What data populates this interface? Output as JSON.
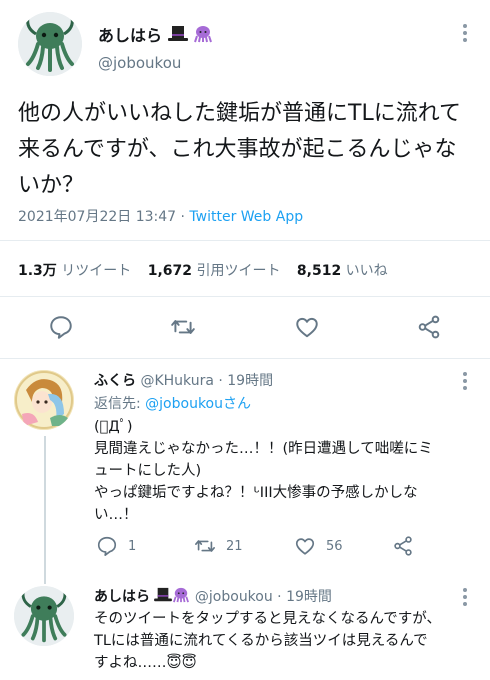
{
  "main_tweet": {
    "display_name": "あしはら",
    "handle": "@joboukou",
    "text": "他の人がいいねした鍵垢が普通にTLに流れて来るんですが、これ大事故が起こるんじゃないか？",
    "timestamp": "2021年07月22日 13:47 · ",
    "app": "Twitter Web App",
    "stats": {
      "retweets_count": "1.3万",
      "retweets_label": "リツイート",
      "quotes_count": "1,672",
      "quotes_label": "引用ツイート",
      "likes_count": "8,512",
      "likes_label": "いいね"
    }
  },
  "reply1": {
    "display_name": "ふくら",
    "handle": "@KHukura",
    "time": " · 19時間",
    "reply_prefix": "返信先: ",
    "reply_to": "@joboukouさん",
    "text_lines": [
      "(ﾟДﾟ)",
      "見間違えじゃなかった…！！(昨日遭遇して咄嗟にミ",
      "ュートにした人)",
      "やっぱ鍵垢ですよね？！ᒡIII大惨事の予感しかしな",
      "い…！"
    ],
    "actions": {
      "reply_count": "1",
      "retweet_count": "21",
      "like_count": "56"
    }
  },
  "reply2": {
    "display_name": "あしはら",
    "handle": "@joboukou",
    "time": " · 19時間",
    "text_lines": [
      "そのツイートをタップすると見えなくなるんですが、",
      "TLには普通に流れてくるから該当ツイは見えるんで",
      "すよね……😇😇"
    ]
  },
  "colors": {
    "accent": "#1da1f2",
    "secondary_text": "#657786",
    "divider": "#e6ecf0"
  }
}
